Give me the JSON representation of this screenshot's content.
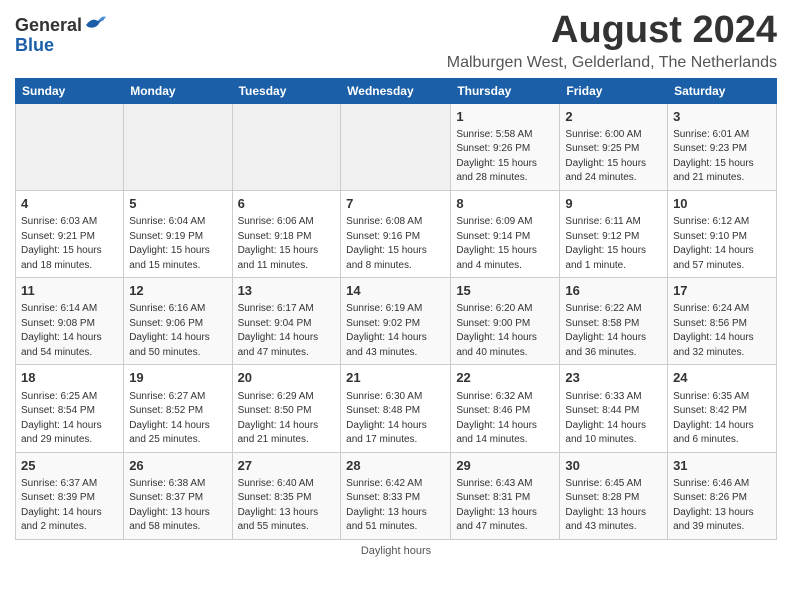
{
  "logo": {
    "general": "General",
    "blue": "Blue"
  },
  "title": "August 2024",
  "subtitle": "Malburgen West, Gelderland, The Netherlands",
  "days_of_week": [
    "Sunday",
    "Monday",
    "Tuesday",
    "Wednesday",
    "Thursday",
    "Friday",
    "Saturday"
  ],
  "weeks": [
    [
      {
        "day": "",
        "info": ""
      },
      {
        "day": "",
        "info": ""
      },
      {
        "day": "",
        "info": ""
      },
      {
        "day": "",
        "info": ""
      },
      {
        "day": "1",
        "info": "Sunrise: 5:58 AM\nSunset: 9:26 PM\nDaylight: 15 hours\nand 28 minutes."
      },
      {
        "day": "2",
        "info": "Sunrise: 6:00 AM\nSunset: 9:25 PM\nDaylight: 15 hours\nand 24 minutes."
      },
      {
        "day": "3",
        "info": "Sunrise: 6:01 AM\nSunset: 9:23 PM\nDaylight: 15 hours\nand 21 minutes."
      }
    ],
    [
      {
        "day": "4",
        "info": "Sunrise: 6:03 AM\nSunset: 9:21 PM\nDaylight: 15 hours\nand 18 minutes."
      },
      {
        "day": "5",
        "info": "Sunrise: 6:04 AM\nSunset: 9:19 PM\nDaylight: 15 hours\nand 15 minutes."
      },
      {
        "day": "6",
        "info": "Sunrise: 6:06 AM\nSunset: 9:18 PM\nDaylight: 15 hours\nand 11 minutes."
      },
      {
        "day": "7",
        "info": "Sunrise: 6:08 AM\nSunset: 9:16 PM\nDaylight: 15 hours\nand 8 minutes."
      },
      {
        "day": "8",
        "info": "Sunrise: 6:09 AM\nSunset: 9:14 PM\nDaylight: 15 hours\nand 4 minutes."
      },
      {
        "day": "9",
        "info": "Sunrise: 6:11 AM\nSunset: 9:12 PM\nDaylight: 15 hours\nand 1 minute."
      },
      {
        "day": "10",
        "info": "Sunrise: 6:12 AM\nSunset: 9:10 PM\nDaylight: 14 hours\nand 57 minutes."
      }
    ],
    [
      {
        "day": "11",
        "info": "Sunrise: 6:14 AM\nSunset: 9:08 PM\nDaylight: 14 hours\nand 54 minutes."
      },
      {
        "day": "12",
        "info": "Sunrise: 6:16 AM\nSunset: 9:06 PM\nDaylight: 14 hours\nand 50 minutes."
      },
      {
        "day": "13",
        "info": "Sunrise: 6:17 AM\nSunset: 9:04 PM\nDaylight: 14 hours\nand 47 minutes."
      },
      {
        "day": "14",
        "info": "Sunrise: 6:19 AM\nSunset: 9:02 PM\nDaylight: 14 hours\nand 43 minutes."
      },
      {
        "day": "15",
        "info": "Sunrise: 6:20 AM\nSunset: 9:00 PM\nDaylight: 14 hours\nand 40 minutes."
      },
      {
        "day": "16",
        "info": "Sunrise: 6:22 AM\nSunset: 8:58 PM\nDaylight: 14 hours\nand 36 minutes."
      },
      {
        "day": "17",
        "info": "Sunrise: 6:24 AM\nSunset: 8:56 PM\nDaylight: 14 hours\nand 32 minutes."
      }
    ],
    [
      {
        "day": "18",
        "info": "Sunrise: 6:25 AM\nSunset: 8:54 PM\nDaylight: 14 hours\nand 29 minutes."
      },
      {
        "day": "19",
        "info": "Sunrise: 6:27 AM\nSunset: 8:52 PM\nDaylight: 14 hours\nand 25 minutes."
      },
      {
        "day": "20",
        "info": "Sunrise: 6:29 AM\nSunset: 8:50 PM\nDaylight: 14 hours\nand 21 minutes."
      },
      {
        "day": "21",
        "info": "Sunrise: 6:30 AM\nSunset: 8:48 PM\nDaylight: 14 hours\nand 17 minutes."
      },
      {
        "day": "22",
        "info": "Sunrise: 6:32 AM\nSunset: 8:46 PM\nDaylight: 14 hours\nand 14 minutes."
      },
      {
        "day": "23",
        "info": "Sunrise: 6:33 AM\nSunset: 8:44 PM\nDaylight: 14 hours\nand 10 minutes."
      },
      {
        "day": "24",
        "info": "Sunrise: 6:35 AM\nSunset: 8:42 PM\nDaylight: 14 hours\nand 6 minutes."
      }
    ],
    [
      {
        "day": "25",
        "info": "Sunrise: 6:37 AM\nSunset: 8:39 PM\nDaylight: 14 hours\nand 2 minutes."
      },
      {
        "day": "26",
        "info": "Sunrise: 6:38 AM\nSunset: 8:37 PM\nDaylight: 13 hours\nand 58 minutes."
      },
      {
        "day": "27",
        "info": "Sunrise: 6:40 AM\nSunset: 8:35 PM\nDaylight: 13 hours\nand 55 minutes."
      },
      {
        "day": "28",
        "info": "Sunrise: 6:42 AM\nSunset: 8:33 PM\nDaylight: 13 hours\nand 51 minutes."
      },
      {
        "day": "29",
        "info": "Sunrise: 6:43 AM\nSunset: 8:31 PM\nDaylight: 13 hours\nand 47 minutes."
      },
      {
        "day": "30",
        "info": "Sunrise: 6:45 AM\nSunset: 8:28 PM\nDaylight: 13 hours\nand 43 minutes."
      },
      {
        "day": "31",
        "info": "Sunrise: 6:46 AM\nSunset: 8:26 PM\nDaylight: 13 hours\nand 39 minutes."
      }
    ]
  ],
  "footer": "Daylight hours"
}
